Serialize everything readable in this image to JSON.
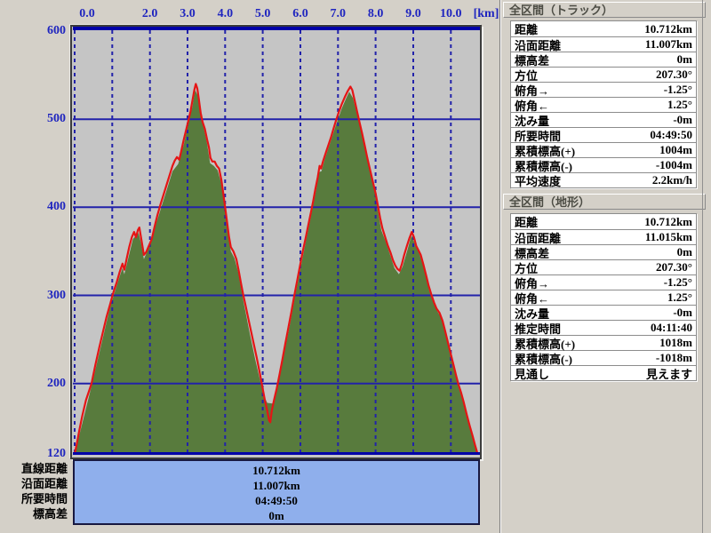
{
  "window": {
    "bg": "#d4d0c8"
  },
  "colors": {
    "axis_text_blue": "#1f25bf",
    "grid_blue": "#2222aa",
    "plot_border_navy": "#0000a8",
    "terrain_green": "#587b3d",
    "track_red": "#e51515",
    "plot_bg": "#c5c5c5",
    "summary_box_bg": "#8fafec",
    "panel_bg": "#d4d0c8"
  },
  "chart_data": {
    "type": "area",
    "title": "",
    "x_unit_label": "[km]",
    "x_range_km": [
      0,
      10.82
    ],
    "y_range_m": [
      120,
      600
    ],
    "x_gridlines_km": [
      0,
      1,
      2,
      3,
      4,
      5,
      6,
      7,
      8,
      9,
      10
    ],
    "y_gridlines_m": [
      200,
      300,
      400,
      500
    ],
    "x_ticks": [
      {
        "km": 0,
        "label": "0.0",
        "dx": 14
      },
      {
        "km": 2,
        "label": "2.0"
      },
      {
        "km": 3,
        "label": "3.0"
      },
      {
        "km": 4,
        "label": "4.0"
      },
      {
        "km": 5,
        "label": "5.0"
      },
      {
        "km": 6,
        "label": "6.0"
      },
      {
        "km": 7,
        "label": "7.0"
      },
      {
        "km": 8,
        "label": "8.0"
      },
      {
        "km": 9,
        "label": "9.0"
      },
      {
        "km": 10,
        "label": "10.0"
      }
    ],
    "y_ticks": [
      {
        "m": 600,
        "label": "600"
      },
      {
        "m": 500,
        "label": "500"
      },
      {
        "m": 400,
        "label": "400"
      },
      {
        "m": 300,
        "label": "300"
      },
      {
        "m": 200,
        "label": "200"
      },
      {
        "m": 120,
        "label": "120"
      }
    ],
    "grid": true,
    "legend": "none",
    "series": [
      {
        "name": "terrain-elevation",
        "type": "area",
        "color": "#587b3d",
        "points": [
          [
            0,
            120
          ],
          [
            0.45,
            197
          ],
          [
            0.95,
            288
          ],
          [
            1.2,
            322
          ],
          [
            1.27,
            331
          ],
          [
            1.32,
            324
          ],
          [
            1.55,
            364
          ],
          [
            1.7,
            371
          ],
          [
            1.77,
            358
          ],
          [
            1.84,
            341
          ],
          [
            1.95,
            352
          ],
          [
            2.2,
            386
          ],
          [
            2.45,
            420
          ],
          [
            2.6,
            441
          ],
          [
            2.75,
            449
          ],
          [
            2.9,
            471
          ],
          [
            3.05,
            501
          ],
          [
            3.13,
            514
          ],
          [
            3.2,
            533
          ],
          [
            3.27,
            527
          ],
          [
            3.33,
            513
          ],
          [
            3.42,
            492
          ],
          [
            3.52,
            472
          ],
          [
            3.6,
            450
          ],
          [
            3.7,
            447
          ],
          [
            3.8,
            442
          ],
          [
            3.88,
            430
          ],
          [
            3.95,
            412
          ],
          [
            4.05,
            378
          ],
          [
            4.15,
            350
          ],
          [
            4.25,
            342
          ],
          [
            4.35,
            326
          ],
          [
            4.5,
            290
          ],
          [
            4.65,
            258
          ],
          [
            4.8,
            227
          ],
          [
            4.95,
            200
          ],
          [
            5.05,
            184
          ],
          [
            5.12,
            178
          ],
          [
            5.3,
            177
          ],
          [
            5.4,
            198
          ],
          [
            5.55,
            230
          ],
          [
            5.7,
            262
          ],
          [
            5.85,
            297
          ],
          [
            6,
            330
          ],
          [
            6.15,
            362
          ],
          [
            6.3,
            394
          ],
          [
            6.42,
            420
          ],
          [
            6.5,
            440
          ],
          [
            6.56,
            441
          ],
          [
            6.65,
            455
          ],
          [
            6.8,
            474
          ],
          [
            6.95,
            494
          ],
          [
            7.1,
            512
          ],
          [
            7.22,
            524
          ],
          [
            7.3,
            531
          ],
          [
            7.4,
            524
          ],
          [
            7.5,
            506
          ],
          [
            7.65,
            480
          ],
          [
            7.8,
            452
          ],
          [
            7.95,
            424
          ],
          [
            8.05,
            398
          ],
          [
            8.15,
            374
          ],
          [
            8.25,
            363
          ],
          [
            8.4,
            344
          ],
          [
            8.5,
            331
          ],
          [
            8.62,
            324
          ],
          [
            8.72,
            333
          ],
          [
            8.85,
            352
          ],
          [
            8.95,
            368
          ],
          [
            9.05,
            358
          ],
          [
            9.17,
            346
          ],
          [
            9.3,
            328
          ],
          [
            9.42,
            306
          ],
          [
            9.55,
            290
          ],
          [
            9.65,
            281
          ],
          [
            9.75,
            274
          ],
          [
            9.9,
            251
          ],
          [
            10.05,
            226
          ],
          [
            10.2,
            196
          ],
          [
            10.35,
            176
          ],
          [
            10.5,
            151
          ],
          [
            10.62,
            133
          ],
          [
            10.71,
            120
          ]
        ]
      },
      {
        "name": "track-elevation",
        "type": "line",
        "color": "#e51515",
        "points": [
          [
            0,
            120
          ],
          [
            0.05,
            130
          ],
          [
            0.12,
            146
          ],
          [
            0.2,
            163
          ],
          [
            0.3,
            181
          ],
          [
            0.45,
            200
          ],
          [
            0.55,
            221
          ],
          [
            0.65,
            240
          ],
          [
            0.75,
            258
          ],
          [
            0.85,
            276
          ],
          [
            0.95,
            291
          ],
          [
            1,
            299
          ],
          [
            1.05,
            306
          ],
          [
            1.12,
            315
          ],
          [
            1.2,
            327
          ],
          [
            1.27,
            336
          ],
          [
            1.32,
            329
          ],
          [
            1.38,
            341
          ],
          [
            1.45,
            355
          ],
          [
            1.52,
            366
          ],
          [
            1.58,
            372
          ],
          [
            1.63,
            366
          ],
          [
            1.68,
            374
          ],
          [
            1.72,
            377
          ],
          [
            1.78,
            362
          ],
          [
            1.84,
            346
          ],
          [
            1.9,
            349
          ],
          [
            1.97,
            356
          ],
          [
            2.05,
            364
          ],
          [
            2.12,
            377
          ],
          [
            2.2,
            391
          ],
          [
            2.28,
            403
          ],
          [
            2.36,
            414
          ],
          [
            2.44,
            425
          ],
          [
            2.52,
            436
          ],
          [
            2.6,
            447
          ],
          [
            2.66,
            453
          ],
          [
            2.72,
            457
          ],
          [
            2.78,
            454
          ],
          [
            2.84,
            465
          ],
          [
            2.9,
            477
          ],
          [
            2.97,
            489
          ],
          [
            3.03,
            500
          ],
          [
            3.08,
            509
          ],
          [
            3.13,
            521
          ],
          [
            3.18,
            533
          ],
          [
            3.22,
            540
          ],
          [
            3.26,
            535
          ],
          [
            3.3,
            523
          ],
          [
            3.35,
            507
          ],
          [
            3.4,
            497
          ],
          [
            3.46,
            489
          ],
          [
            3.52,
            477
          ],
          [
            3.57,
            468
          ],
          [
            3.61,
            456
          ],
          [
            3.66,
            452
          ],
          [
            3.72,
            452
          ],
          [
            3.78,
            447
          ],
          [
            3.84,
            444
          ],
          [
            3.9,
            431
          ],
          [
            3.95,
            416
          ],
          [
            4,
            400
          ],
          [
            4.05,
            384
          ],
          [
            4.1,
            367
          ],
          [
            4.15,
            355
          ],
          [
            4.22,
            350
          ],
          [
            4.3,
            341
          ],
          [
            4.36,
            328
          ],
          [
            4.42,
            314
          ],
          [
            4.48,
            301
          ],
          [
            4.54,
            289
          ],
          [
            4.6,
            277
          ],
          [
            4.68,
            261
          ],
          [
            4.76,
            245
          ],
          [
            4.84,
            229
          ],
          [
            4.92,
            212
          ],
          [
            5,
            194
          ],
          [
            5.06,
            180
          ],
          [
            5.12,
            169
          ],
          [
            5.17,
            158
          ],
          [
            5.2,
            156
          ],
          [
            5.24,
            169
          ],
          [
            5.3,
            181
          ],
          [
            5.37,
            194
          ],
          [
            5.44,
            209
          ],
          [
            5.52,
            227
          ],
          [
            5.6,
            245
          ],
          [
            5.68,
            263
          ],
          [
            5.76,
            281
          ],
          [
            5.84,
            300
          ],
          [
            5.92,
            318
          ],
          [
            6,
            336
          ],
          [
            6.07,
            351
          ],
          [
            6.14,
            365
          ],
          [
            6.21,
            380
          ],
          [
            6.28,
            394
          ],
          [
            6.34,
            407
          ],
          [
            6.4,
            421
          ],
          [
            6.46,
            434
          ],
          [
            6.51,
            447
          ],
          [
            6.55,
            444
          ],
          [
            6.6,
            452
          ],
          [
            6.67,
            461
          ],
          [
            6.74,
            470
          ],
          [
            6.81,
            479
          ],
          [
            6.88,
            489
          ],
          [
            6.95,
            499
          ],
          [
            7.02,
            508
          ],
          [
            7.1,
            517
          ],
          [
            7.18,
            525
          ],
          [
            7.26,
            532
          ],
          [
            7.33,
            537
          ],
          [
            7.38,
            533
          ],
          [
            7.44,
            522
          ],
          [
            7.5,
            510
          ],
          [
            7.57,
            497
          ],
          [
            7.64,
            484
          ],
          [
            7.71,
            470
          ],
          [
            7.78,
            456
          ],
          [
            7.85,
            443
          ],
          [
            7.92,
            430
          ],
          [
            8,
            416
          ],
          [
            8.06,
            402
          ],
          [
            8.12,
            388
          ],
          [
            8.18,
            376
          ],
          [
            8.24,
            368
          ],
          [
            8.32,
            357
          ],
          [
            8.4,
            348
          ],
          [
            8.46,
            340
          ],
          [
            8.52,
            334
          ],
          [
            8.58,
            330
          ],
          [
            8.64,
            328
          ],
          [
            8.7,
            336
          ],
          [
            8.76,
            346
          ],
          [
            8.83,
            356
          ],
          [
            8.9,
            365
          ],
          [
            8.96,
            372
          ],
          [
            9.02,
            366
          ],
          [
            9.08,
            356
          ],
          [
            9.14,
            351
          ],
          [
            9.2,
            346
          ],
          [
            9.27,
            335
          ],
          [
            9.34,
            323
          ],
          [
            9.41,
            311
          ],
          [
            9.48,
            301
          ],
          [
            9.55,
            292
          ],
          [
            9.62,
            285
          ],
          [
            9.7,
            280
          ],
          [
            9.78,
            271
          ],
          [
            9.85,
            259
          ],
          [
            9.92,
            247
          ],
          [
            10,
            233
          ],
          [
            10.07,
            221
          ],
          [
            10.14,
            209
          ],
          [
            10.2,
            199
          ],
          [
            10.27,
            190
          ],
          [
            10.34,
            179
          ],
          [
            10.42,
            165
          ],
          [
            10.5,
            152
          ],
          [
            10.58,
            140
          ],
          [
            10.65,
            129
          ],
          [
            10.71,
            120
          ]
        ]
      }
    ]
  },
  "summary": {
    "labels": [
      "直線距離",
      "沿面距離",
      "所要時間",
      "標高差"
    ],
    "values": [
      "10.712km",
      "11.007km",
      "04:49:50",
      "0m"
    ]
  },
  "panels": [
    {
      "title": "全区間（トラック）",
      "rows": [
        {
          "label": "距離",
          "value": "10.712km"
        },
        {
          "label": "沿面距離",
          "value": "11.007km"
        },
        {
          "label": "標高差",
          "value": "0m"
        },
        {
          "label": "方位",
          "value": "207.30°"
        },
        {
          "label": "俯角→",
          "value": "-1.25°"
        },
        {
          "label": "俯角←",
          "value": "1.25°"
        },
        {
          "label": "沈み量",
          "value": "-0m"
        },
        {
          "label": "所要時間",
          "value": "04:49:50"
        },
        {
          "label": "累積標高(+)",
          "value": "1004m"
        },
        {
          "label": "累積標高(-)",
          "value": "-1004m"
        },
        {
          "label": "平均速度",
          "value": "2.2km/h"
        }
      ]
    },
    {
      "title": "全区間（地形）",
      "rows": [
        {
          "label": "距離",
          "value": "10.712km"
        },
        {
          "label": "沿面距離",
          "value": "11.015km"
        },
        {
          "label": "標高差",
          "value": "0m"
        },
        {
          "label": "方位",
          "value": "207.30°"
        },
        {
          "label": "俯角→",
          "value": "-1.25°"
        },
        {
          "label": "俯角←",
          "value": "1.25°"
        },
        {
          "label": "沈み量",
          "value": "-0m"
        },
        {
          "label": "推定時間",
          "value": "04:11:40"
        },
        {
          "label": "累積標高(+)",
          "value": "1018m"
        },
        {
          "label": "累積標高(-)",
          "value": "-1018m"
        },
        {
          "label": "見通し",
          "value": "見えます"
        }
      ]
    }
  ]
}
